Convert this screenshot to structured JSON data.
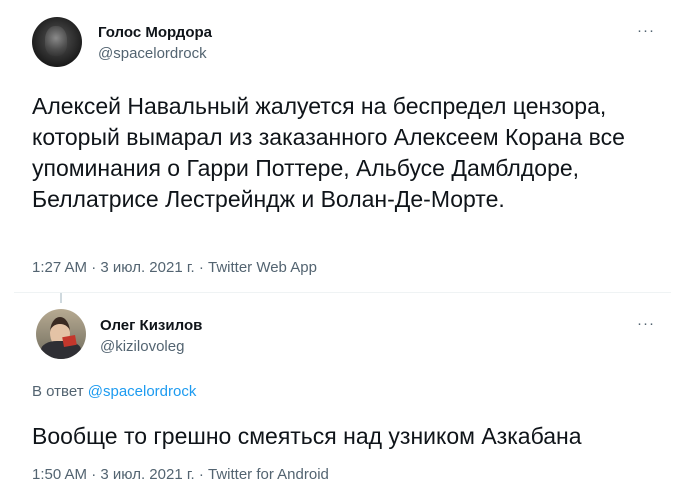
{
  "tweet_main": {
    "display_name": "Голос Мордора",
    "handle": "@spacelordrock",
    "more_label": "···",
    "text": "Алексей Навальный жалуется на беспредел цензора, который вымарал из заказанного Алексеем Корана все упоминания о Гарри Поттере, Альбусе Дамблдоре, Беллатрисе Лестрейндж и Волан-Де-Морте.",
    "time": "1:27 AM",
    "date": "3 июл. 2021 г.",
    "source": "Twitter Web App",
    "separator": "·"
  },
  "tweet_reply": {
    "display_name": "Олег Кизилов",
    "handle": "@kizilovoleg",
    "more_label": "···",
    "reply_prefix": "В ответ",
    "reply_mention": "@spacelordrock",
    "text": "Вообще то грешно смеяться над узником Азкабана",
    "time": "1:50 AM",
    "date": "3 июл. 2021 г.",
    "source": "Twitter for Android",
    "separator": "·"
  },
  "icons": {
    "avatar_main": "avatar-image",
    "avatar_reply": "avatar-image",
    "more": "more-horizontal-icon"
  },
  "colors": {
    "text_primary": "#0f1419",
    "text_secondary": "#536471",
    "link_blue": "#1d9bf0",
    "divider": "#eff3f4"
  }
}
